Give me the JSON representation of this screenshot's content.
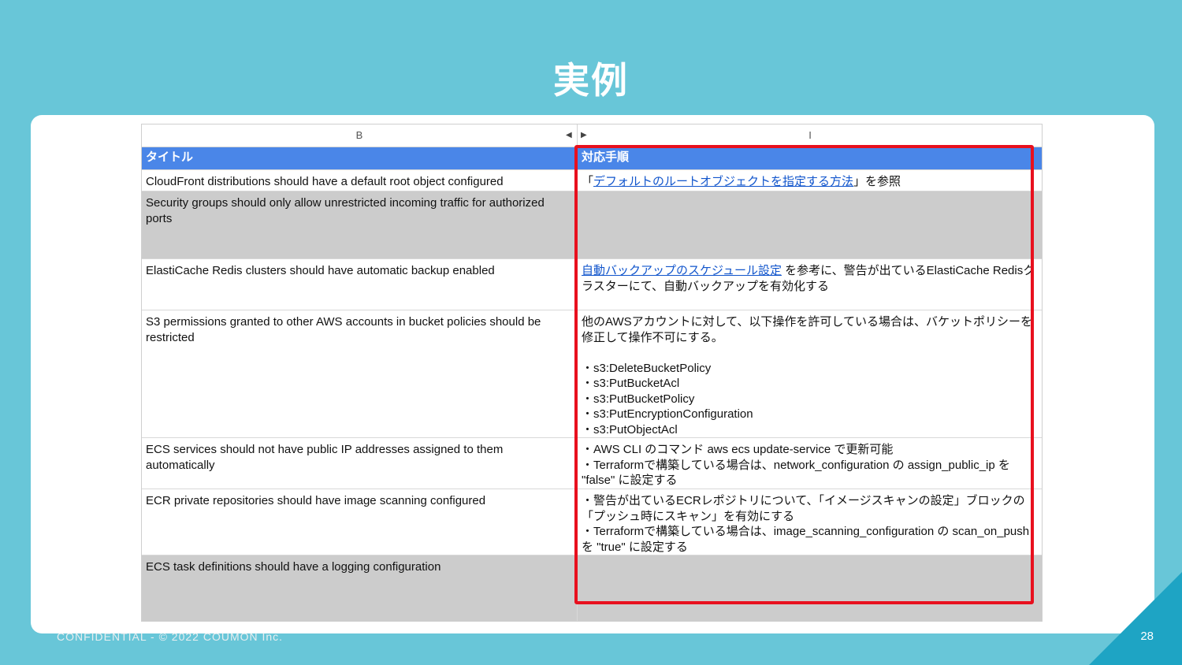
{
  "slide": {
    "title": "実例",
    "footer": "CONFIDENTIAL - © 2022 COUMON Inc.",
    "page_number": "28"
  },
  "sheet": {
    "columns": {
      "b": "B",
      "i": "I"
    },
    "header": {
      "title": "タイトル",
      "procedure": "対応手順"
    },
    "rows": [
      {
        "title": "CloudFront distributions should have a default root object configured",
        "procedure": {
          "prefix": "「",
          "link": "デフォルトのルートオブジェクトを指定する方法",
          "suffix": "」を参照"
        }
      },
      {
        "title": "Security groups should only allow unrestricted incoming traffic for authorized ports",
        "procedure": ""
      },
      {
        "title": "ElastiCache Redis clusters should have automatic backup enabled",
        "procedure": {
          "link": "自動バックアップのスケジュール設定",
          "suffix": " を参考に、警告が出ているElastiCache Redisクラスターにて、自動バックアップを有効化する"
        }
      },
      {
        "title": "S3 permissions granted to other AWS accounts in bucket policies should be restricted",
        "procedure": {
          "intro": "他のAWSアカウントに対して、以下操作を許可している場合は、バケットポリシーを修正して操作不可にする。",
          "items": [
            "・s3:DeleteBucketPolicy",
            "・s3:PutBucketAcl",
            "・s3:PutBucketPolicy",
            "・s3:PutEncryptionConfiguration",
            "・s3:PutObjectAcl"
          ]
        }
      },
      {
        "title": "ECS services should not have public IP addresses assigned to them automatically",
        "procedure": {
          "lines": [
            "・AWS CLI のコマンド aws ecs update-service で更新可能",
            "・Terraformで構築している場合は、network_configuration の assign_public_ip を \"false\" に設定する"
          ]
        }
      },
      {
        "title": "ECR private repositories should have image scanning configured",
        "procedure": {
          "lines": [
            "・警告が出ているECRレポジトリについて、「イメージスキャンの設定」ブロックの「プッシュ時にスキャン」を有効にする",
            "・Terraformで構築している場合は、image_scanning_configuration の scan_on_push を \"true\" に設定する"
          ]
        }
      },
      {
        "title": "ECS task definitions should have a logging configuration",
        "procedure": ""
      }
    ]
  },
  "colors": {
    "background": "#68c6d8",
    "header_row": "#4a86e8",
    "gray_row": "#cccccc",
    "highlight": "#e8101e",
    "link": "#1155cc"
  }
}
